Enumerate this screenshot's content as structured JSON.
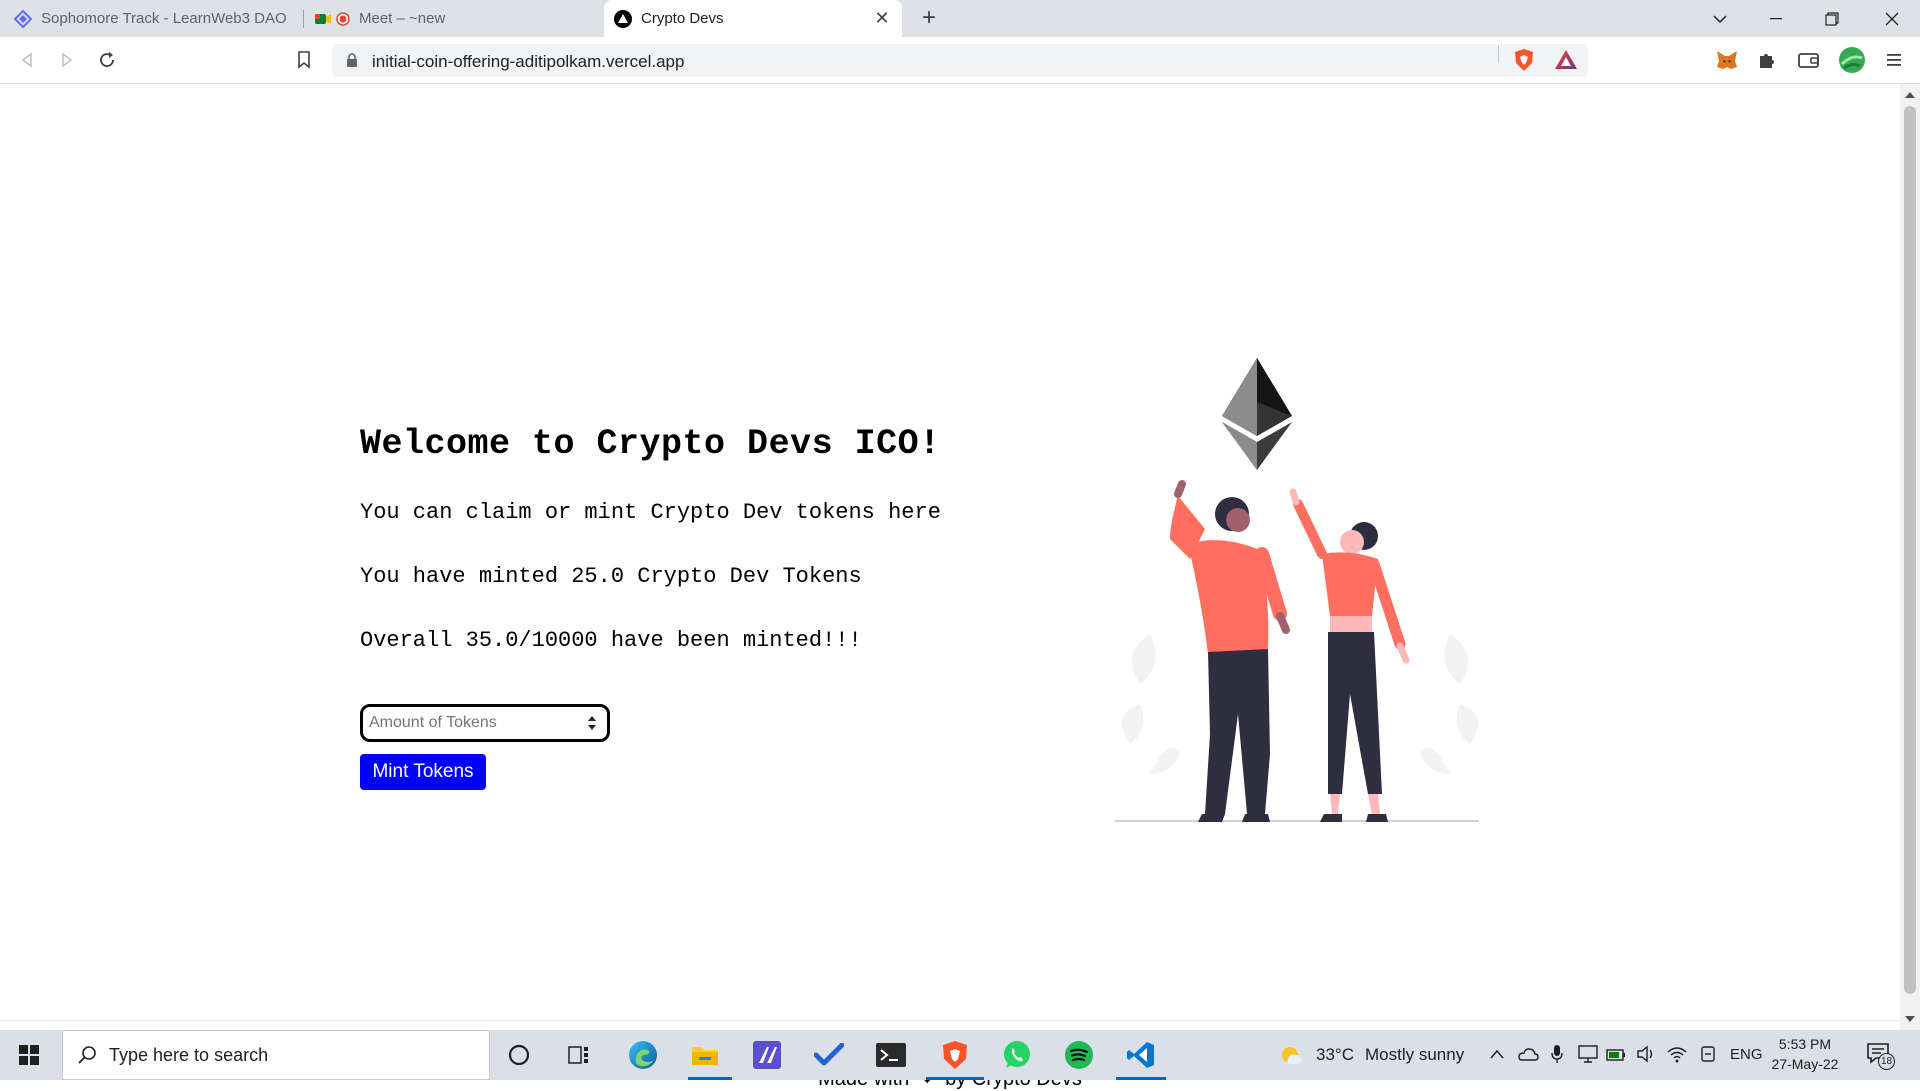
{
  "browser": {
    "tabs": [
      {
        "title": "Sophomore Track - LearnWeb3 DAO",
        "active": false
      },
      {
        "title": "Meet – ~new",
        "active": false
      },
      {
        "title": "Crypto Devs",
        "active": true
      }
    ],
    "tab_close_label": "✕",
    "new_tab_label": "+",
    "url": "initial-coin-offering-aditipolkam.vercel.app"
  },
  "page": {
    "title": "Welcome to Crypto Devs ICO!",
    "claim_text": "You can claim or mint Crypto Dev tokens here",
    "minted_text": "You have minted 25.0 Crypto Dev Tokens",
    "overall_text": "Overall 35.0/10000 have been minted!!!",
    "amount_placeholder": "Amount of Tokens",
    "mint_button": "Mint Tokens",
    "footer_prefix": "Made with",
    "footer_heart": "❤",
    "footer_suffix": "by Crypto Devs"
  },
  "taskbar": {
    "search_placeholder": "Type here to search",
    "weather_temp": "33°C",
    "weather_desc": "Mostly sunny",
    "language": "ENG",
    "time": "5:53 PM",
    "date": "27-May-22",
    "notifications": "18"
  },
  "colors": {
    "mint_button": "#0000ff",
    "person_top": "#ff6f61",
    "person_pants": "#2f2e41"
  }
}
